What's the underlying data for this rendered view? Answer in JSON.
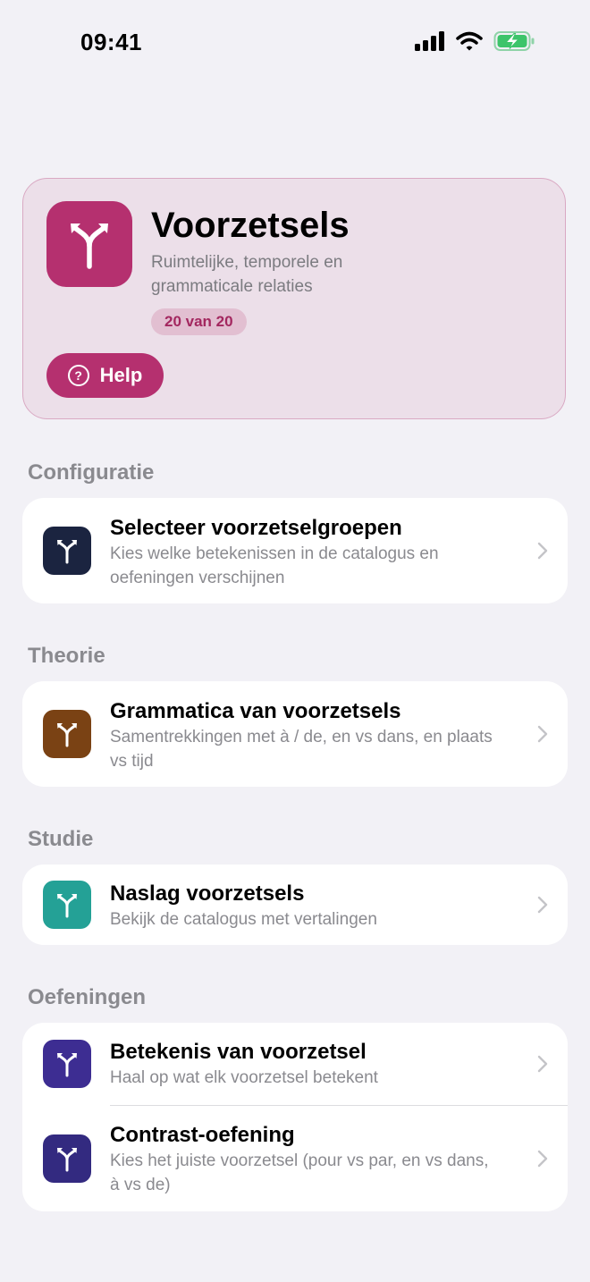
{
  "status_bar": {
    "time": "09:41"
  },
  "hero": {
    "title": "Voorzetsels",
    "subtitle": "Ruimtelijke, temporele en grammaticale relaties",
    "badge": "20 van 20",
    "help_label": "Help",
    "help_glyph": "?",
    "icon": "split-arrow-icon",
    "accent": "#b5306f"
  },
  "sections": {
    "configuratie": {
      "header": "Configuratie",
      "items": [
        {
          "title": "Selecteer voorzetselgroepen",
          "subtitle": "Kies welke betekenissen in de catalogus en oefeningen verschijnen",
          "color": "#1b2440"
        }
      ]
    },
    "theorie": {
      "header": "Theorie",
      "items": [
        {
          "title": "Grammatica van voorzetsels",
          "subtitle": "Samentrekkingen met à / de, en vs dans, en plaats vs tijd",
          "color": "#7a4214"
        }
      ]
    },
    "studie": {
      "header": "Studie",
      "items": [
        {
          "title": "Naslag voorzetsels",
          "subtitle": "Bekijk de catalogus met vertalingen",
          "color": "#24a196"
        }
      ]
    },
    "oefeningen": {
      "header": "Oefeningen",
      "items": [
        {
          "title": "Betekenis van voorzetsel",
          "subtitle": "Haal op wat elk voorzetsel betekent",
          "color": "#3d2d92"
        },
        {
          "title": "Contrast-oefening",
          "subtitle": "Kies het juiste voorzetsel (pour vs par, en vs dans, à vs de)",
          "color": "#332a80"
        }
      ]
    }
  }
}
